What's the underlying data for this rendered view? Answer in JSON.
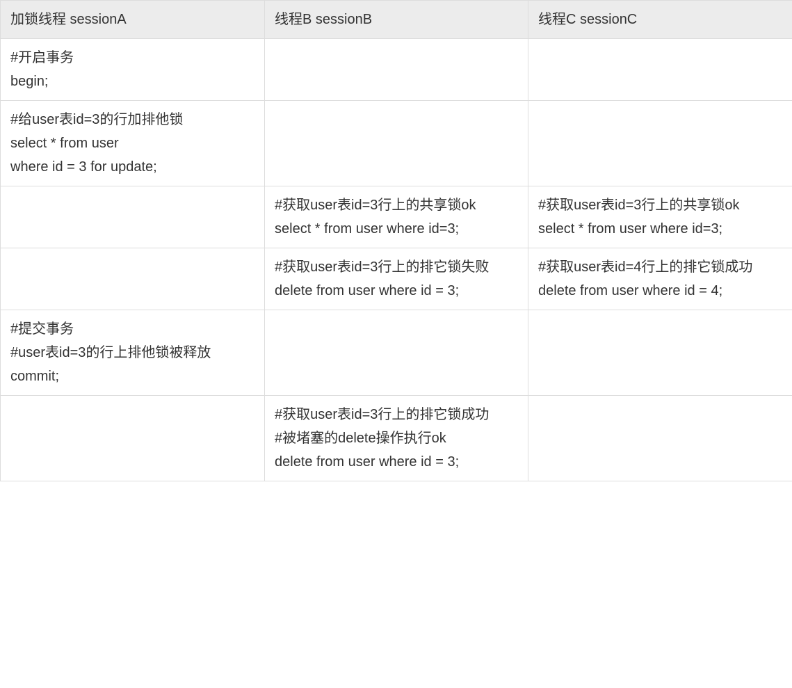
{
  "table": {
    "headers": [
      "加锁线程 sessionA",
      "线程B sessionB",
      "线程C sessionC"
    ],
    "rows": [
      {
        "a": "#开启事务\nbegin;",
        "b": "",
        "c": ""
      },
      {
        "a": "#给user表id=3的行加排他锁\nselect * from user\nwhere id = 3 for update;",
        "b": "",
        "c": ""
      },
      {
        "a": "",
        "b": "#获取user表id=3行上的共享锁ok\nselect * from user where id=3;",
        "c": "#获取user表id=3行上的共享锁ok\nselect * from user where id=3;"
      },
      {
        "a": "",
        "b": "#获取user表id=3行上的排它锁失败\ndelete from user where id = 3;",
        "c": "#获取user表id=4行上的排它锁成功\ndelete from user where id = 4;"
      },
      {
        "a": "#提交事务\n#user表id=3的行上排他锁被释放\ncommit;",
        "b": "",
        "c": ""
      },
      {
        "a": "",
        "b": "#获取user表id=3行上的排它锁成功\n#被堵塞的delete操作执行ok\ndelete from user where id = 3;",
        "c": ""
      }
    ]
  }
}
